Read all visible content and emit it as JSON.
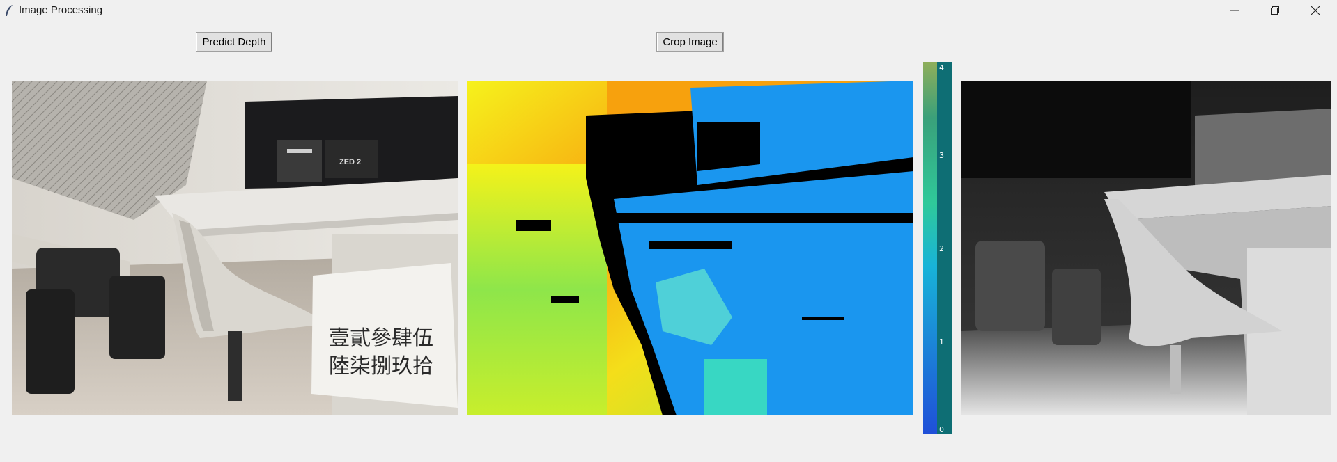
{
  "window": {
    "title": "Image Processing",
    "icon": "feather-icon",
    "controls": [
      "minimize-icon",
      "restore-icon",
      "close-icon"
    ]
  },
  "toolbar": {
    "predict_label": "Predict Depth",
    "crop_label": "Crop Image"
  },
  "panels": {
    "original": {
      "note_line1": "壹貳參肆伍",
      "note_line2": "陸柒捌玖拾"
    }
  },
  "colorbar": {
    "ticks": [
      "4",
      "3",
      "2",
      "1",
      "0"
    ],
    "gradient": [
      "#1f4fd8",
      "#18b3d8",
      "#2fc99a",
      "#0e6e74",
      "#8fae5a"
    ]
  }
}
